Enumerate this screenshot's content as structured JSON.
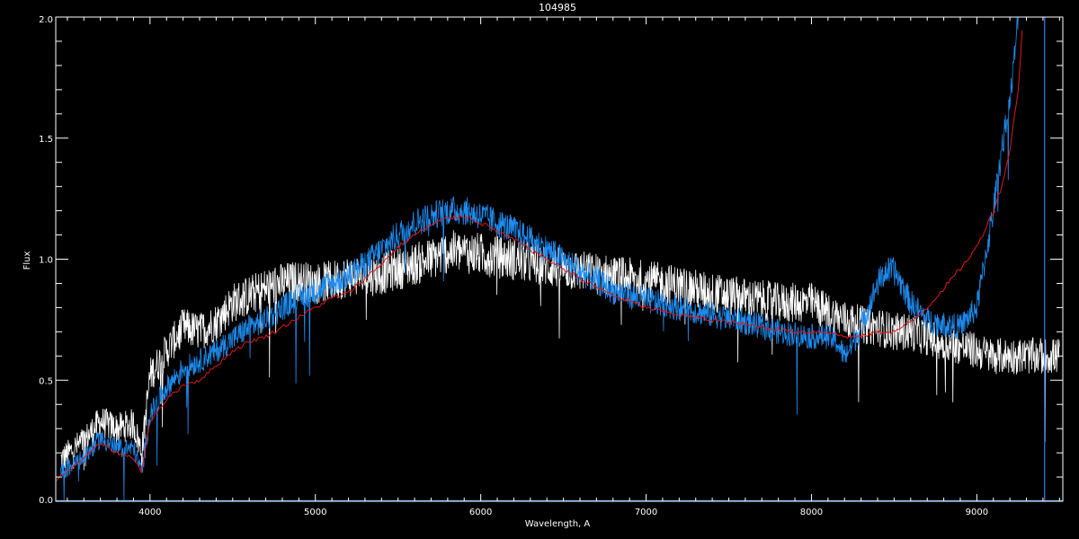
{
  "chart_data": {
    "type": "line",
    "title": "104985",
    "xlabel": "Wavelength, A",
    "ylabel": "Flux",
    "xlim": [
      3430,
      9520
    ],
    "ylim": [
      0.0,
      2.0
    ],
    "xticks": [
      4000,
      5000,
      6000,
      7000,
      8000,
      9000
    ],
    "xtick_labels": [
      "4000",
      "5000",
      "6000",
      "7000",
      "8000",
      "9000"
    ],
    "yticks": [
      0.0,
      0.5,
      1.0,
      1.5,
      2.0
    ],
    "ytick_labels": [
      "0.0",
      "0.5",
      "1.0",
      "1.5",
      "2.0"
    ],
    "grid": false,
    "background": "#000000",
    "axis_color": "#ffffff",
    "series": [
      {
        "color": "#ffffff",
        "noise": 0.09,
        "x": [
          3460,
          3600,
          3700,
          3800,
          3900,
          3950,
          4000,
          4100,
          4200,
          4300,
          4400,
          4500,
          4600,
          4700,
          4800,
          4900,
          5000,
          5100,
          5200,
          5300,
          5400,
          5500,
          5600,
          5700,
          5800,
          5900,
          6000,
          6200,
          6400,
          6600,
          6800,
          7000,
          7200,
          7400,
          7600,
          7800,
          7900,
          8000,
          8100,
          8200,
          8300,
          8400,
          8500,
          8600,
          8700,
          8800,
          8900,
          9000,
          9100,
          9200,
          9300,
          9400,
          9500
        ],
        "y": [
          0.17,
          0.25,
          0.33,
          0.3,
          0.32,
          0.2,
          0.52,
          0.62,
          0.72,
          0.7,
          0.74,
          0.82,
          0.85,
          0.88,
          0.9,
          0.91,
          0.9,
          0.91,
          0.93,
          0.93,
          0.94,
          0.96,
          0.98,
          1.0,
          1.03,
          1.03,
          1.02,
          1.0,
          0.97,
          0.95,
          0.93,
          0.91,
          0.89,
          0.86,
          0.84,
          0.82,
          0.82,
          0.82,
          0.78,
          0.75,
          0.73,
          0.72,
          0.7,
          0.7,
          0.68,
          0.65,
          0.64,
          0.62,
          0.6,
          0.6,
          0.6,
          0.6,
          0.6
        ]
      },
      {
        "color": "#1e8cf0",
        "noise": 0.06,
        "x": [
          3460,
          3600,
          3700,
          3800,
          3900,
          3950,
          4000,
          4100,
          4200,
          4300,
          4400,
          4500,
          4600,
          4700,
          4800,
          4900,
          5000,
          5100,
          5200,
          5300,
          5400,
          5500,
          5600,
          5700,
          5800,
          5900,
          6000,
          6200,
          6400,
          6600,
          6800,
          7000,
          7200,
          7400,
          7600,
          7800,
          7900,
          8000,
          8100,
          8150,
          8200,
          8250,
          8300,
          8400,
          8450,
          8500,
          8550,
          8600,
          8700,
          8800,
          8900,
          9000,
          9100,
          9150,
          9200,
          9230,
          9250
        ],
        "y": [
          0.12,
          0.18,
          0.26,
          0.22,
          0.22,
          0.12,
          0.36,
          0.47,
          0.55,
          0.58,
          0.62,
          0.67,
          0.72,
          0.75,
          0.8,
          0.84,
          0.87,
          0.9,
          0.93,
          0.98,
          1.04,
          1.1,
          1.15,
          1.18,
          1.2,
          1.2,
          1.18,
          1.12,
          1.04,
          0.95,
          0.87,
          0.83,
          0.8,
          0.77,
          0.74,
          0.7,
          0.69,
          0.68,
          0.68,
          0.66,
          0.6,
          0.65,
          0.72,
          0.9,
          0.95,
          0.95,
          0.89,
          0.82,
          0.75,
          0.73,
          0.72,
          0.8,
          1.2,
          1.45,
          1.65,
          1.85,
          2.0
        ]
      },
      {
        "color": "#e01818",
        "noise": 0.01,
        "x": [
          3430,
          3500,
          3600,
          3700,
          3800,
          3900,
          3950,
          4000,
          4100,
          4200,
          4300,
          4400,
          4500,
          4600,
          4700,
          4800,
          4900,
          5000,
          5100,
          5200,
          5300,
          5400,
          5500,
          5600,
          5700,
          5800,
          5900,
          6000,
          6200,
          6400,
          6600,
          6800,
          7000,
          7200,
          7400,
          7600,
          7800,
          7900,
          8000,
          8100,
          8200,
          8300,
          8400,
          8500,
          8600,
          8700,
          8800,
          8900,
          9000,
          9100,
          9150,
          9200,
          9250,
          9280
        ],
        "y": [
          0.09,
          0.12,
          0.18,
          0.24,
          0.2,
          0.18,
          0.12,
          0.33,
          0.42,
          0.48,
          0.5,
          0.56,
          0.62,
          0.66,
          0.68,
          0.72,
          0.76,
          0.8,
          0.84,
          0.86,
          0.92,
          0.98,
          1.05,
          1.1,
          1.14,
          1.17,
          1.18,
          1.15,
          1.08,
          1.0,
          0.92,
          0.85,
          0.8,
          0.77,
          0.75,
          0.73,
          0.71,
          0.7,
          0.7,
          0.7,
          0.68,
          0.68,
          0.7,
          0.7,
          0.74,
          0.8,
          0.88,
          0.96,
          1.05,
          1.2,
          1.3,
          1.45,
          1.7,
          2.0
        ]
      }
    ],
    "vertical_lines": [
      {
        "x": 9410,
        "color": "#3a7cf0"
      }
    ]
  }
}
